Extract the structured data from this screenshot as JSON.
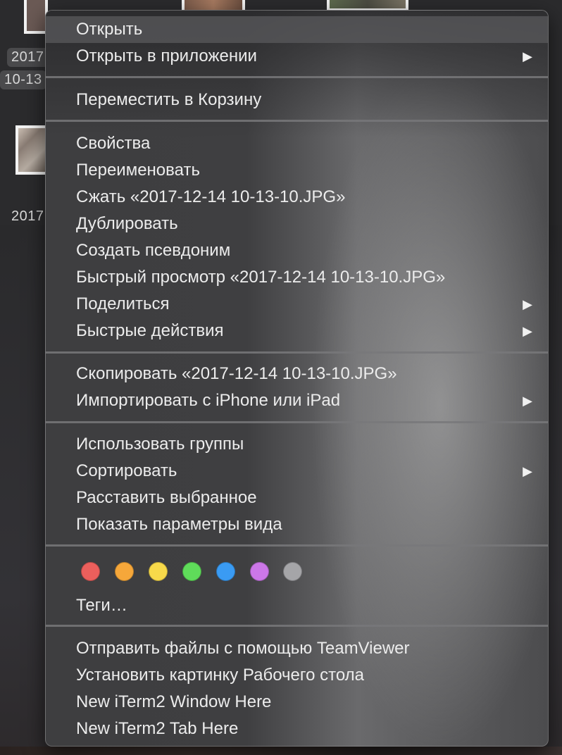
{
  "finder": {
    "thumb_labels": [
      "2017",
      "10-13",
      "2017"
    ]
  },
  "menu": {
    "sections": [
      [
        {
          "label": "Открыть",
          "submenu": false
        },
        {
          "label": "Открыть в приложении",
          "submenu": true
        }
      ],
      [
        {
          "label": "Переместить в Корзину",
          "submenu": false
        }
      ],
      [
        {
          "label": "Свойства",
          "submenu": false
        },
        {
          "label": "Переименовать",
          "submenu": false
        },
        {
          "label": "Сжать «2017-12-14 10-13-10.JPG»",
          "submenu": false
        },
        {
          "label": "Дублировать",
          "submenu": false
        },
        {
          "label": "Создать псевдоним",
          "submenu": false
        },
        {
          "label": "Быстрый просмотр «2017-12-14 10-13-10.JPG»",
          "submenu": false
        },
        {
          "label": "Поделиться",
          "submenu": true
        },
        {
          "label": "Быстрые действия",
          "submenu": true
        }
      ],
      [
        {
          "label": "Скопировать «2017-12-14 10-13-10.JPG»",
          "submenu": false
        },
        {
          "label": "Импортировать с iPhone или iPad",
          "submenu": true
        }
      ],
      [
        {
          "label": "Использовать группы",
          "submenu": false
        },
        {
          "label": "Сортировать",
          "submenu": true
        },
        {
          "label": "Расставить выбранное",
          "submenu": false
        },
        {
          "label": "Показать параметры вида",
          "submenu": false
        }
      ],
      [
        {
          "label": "Теги…",
          "submenu": false
        }
      ],
      [
        {
          "label": "Отправить файлы с помощью TeamViewer",
          "submenu": false
        },
        {
          "label": "Установить картинку Рабочего стола",
          "submenu": false
        },
        {
          "label": "New iTerm2 Window Here",
          "submenu": false
        },
        {
          "label": "New iTerm2 Tab Here",
          "submenu": false
        }
      ]
    ],
    "submenu_arrow": "▶",
    "tag_colors": [
      {
        "name": "red-tag",
        "color": "#ec5f5c"
      },
      {
        "name": "orange-tag",
        "color": "#f6a73a"
      },
      {
        "name": "yellow-tag",
        "color": "#f7d94a"
      },
      {
        "name": "green-tag",
        "color": "#5fdc5a"
      },
      {
        "name": "blue-tag",
        "color": "#3a9bf3"
      },
      {
        "name": "purple-tag",
        "color": "#cc77e8"
      },
      {
        "name": "gray-tag",
        "color": "#a5a5a8"
      }
    ]
  }
}
